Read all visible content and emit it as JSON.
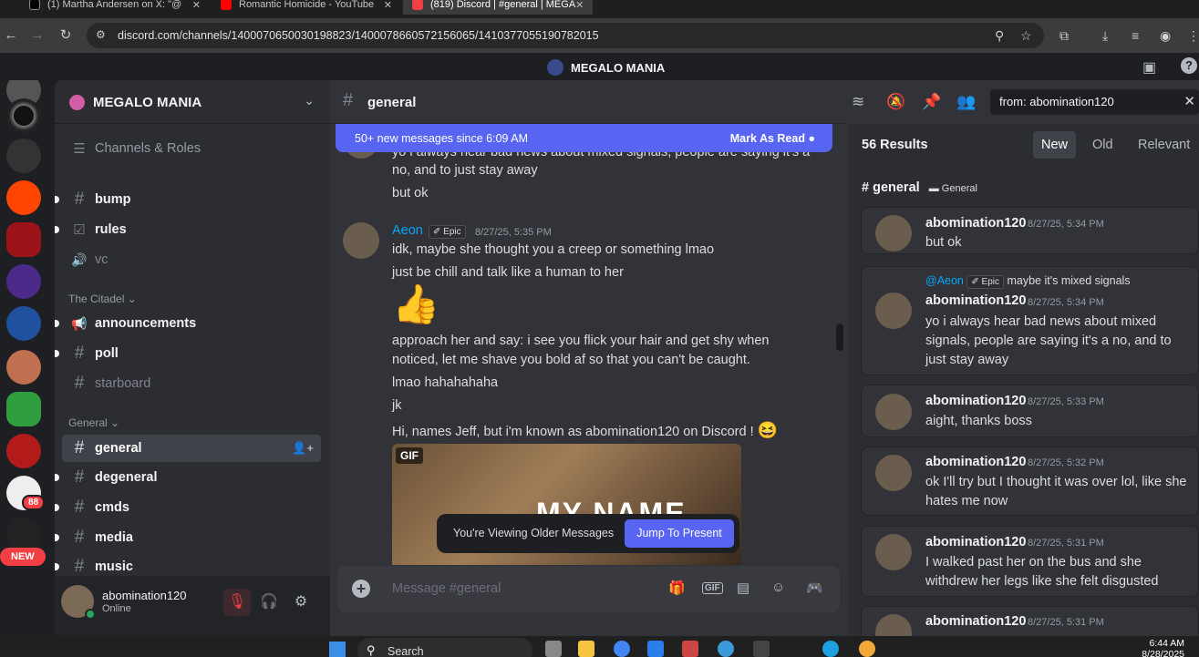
{
  "browser": {
    "tabs": [
      {
        "title": "(1) Martha Andersen on X: \"@",
        "active": false
      },
      {
        "title": "Romantic Homicide - YouTube",
        "active": false
      },
      {
        "title": "(819) Discord | #general | MEGA",
        "active": true
      }
    ],
    "url": "discord.com/channels/1400070650030198823/1400078660572156065/1410377055190782015"
  },
  "app_title": "MEGALO MANIA",
  "server": {
    "name": "MEGALO MANIA",
    "channels_roles": "Channels & Roles",
    "channels": [
      {
        "name": "bump",
        "icon": "#",
        "state": "unread"
      },
      {
        "name": "rules",
        "icon": "☑",
        "state": "unread"
      },
      {
        "name": "vc",
        "icon": "🔊",
        "state": "muted"
      }
    ],
    "category_1": "The Citadel",
    "citadel_channels": [
      {
        "name": "announcements",
        "icon": "📢",
        "state": "unread"
      },
      {
        "name": "poll",
        "icon": "#",
        "state": "unread"
      },
      {
        "name": "starboard",
        "icon": "#",
        "state": "muted"
      }
    ],
    "category_2": "General",
    "general_channels": [
      {
        "name": "general",
        "icon": "#",
        "state": "selected"
      },
      {
        "name": "degeneral",
        "icon": "#",
        "state": "unread"
      },
      {
        "name": "cmds",
        "icon": "#",
        "state": "unread"
      },
      {
        "name": "media",
        "icon": "#",
        "state": "unread"
      },
      {
        "name": "music",
        "icon": "#",
        "state": "unread"
      }
    ]
  },
  "rail": {
    "badge": "88",
    "new_label": "NEW"
  },
  "user": {
    "name": "abomination120",
    "status": "Online"
  },
  "chat": {
    "channel": "general",
    "new_messages_bar": "50+ new messages since 6:09 AM",
    "mark_as_read": "Mark As Read",
    "prev_lines": [
      "yo i always hear bad news about mixed signals, people are saying it's a",
      "no, and to just stay away",
      "but ok"
    ],
    "message": {
      "author": "Aeon",
      "tag": "Epic",
      "timestamp": "8/27/25, 5:35 PM",
      "lines": [
        "idk, maybe she thought you a creep or something lmao",
        "just be chill and talk like a human to her"
      ],
      "emoji": "👍",
      "more_lines": [
        "approach her and say: i see you flick your hair and get shy when",
        "noticed, let me shave you bold af so that you can't be caught.",
        "lmao hahahahaha",
        "jk",
        "Hi, names Jeff, but i'm known as abomination120 on Discord !"
      ],
      "laugh_emoji": "😆",
      "gif_label": "GIF",
      "gif_text": "MY NAME"
    },
    "older_notice": "You're Viewing Older Messages",
    "jump_button": "Jump To Present",
    "composer_placeholder": "Message #general"
  },
  "search": {
    "query": "from: abomination120",
    "results_count": "56 Results",
    "sort": [
      "New",
      "Old",
      "Relevant"
    ],
    "group_channel": "general",
    "group_category": "General",
    "results": [
      {
        "author": "abomination120",
        "timestamp": "8/27/25, 5:34 PM",
        "text": "but ok"
      },
      {
        "reply_to": "@Aeon",
        "reply_tag": "Epic",
        "reply_text": "maybe it's mixed signals",
        "author": "abomination120",
        "timestamp": "8/27/25, 5:34 PM",
        "text": "yo i always hear bad news about mixed signals, people are saying it's a no, and to just stay away"
      },
      {
        "author": "abomination120",
        "timestamp": "8/27/25, 5:33 PM",
        "text": "aight, thanks boss"
      },
      {
        "author": "abomination120",
        "timestamp": "8/27/25, 5:32 PM",
        "text": "ok I'll try but I thought it was over lol, like she hates me now"
      },
      {
        "author": "abomination120",
        "timestamp": "8/27/25, 5:31 PM",
        "text": "I walked past her on the bus and she withdrew her legs like she felt disgusted"
      },
      {
        "author": "abomination120",
        "timestamp": "8/27/25, 5:31 PM",
        "text": ""
      }
    ]
  },
  "taskbar": {
    "search": "Search",
    "time": "6:44 AM",
    "date": "8/28/2025"
  },
  "colors": {
    "blurple": "#5865f2",
    "online": "#23a55a",
    "mention": "#00a8fc",
    "aeon_name": "#00a8fc"
  }
}
